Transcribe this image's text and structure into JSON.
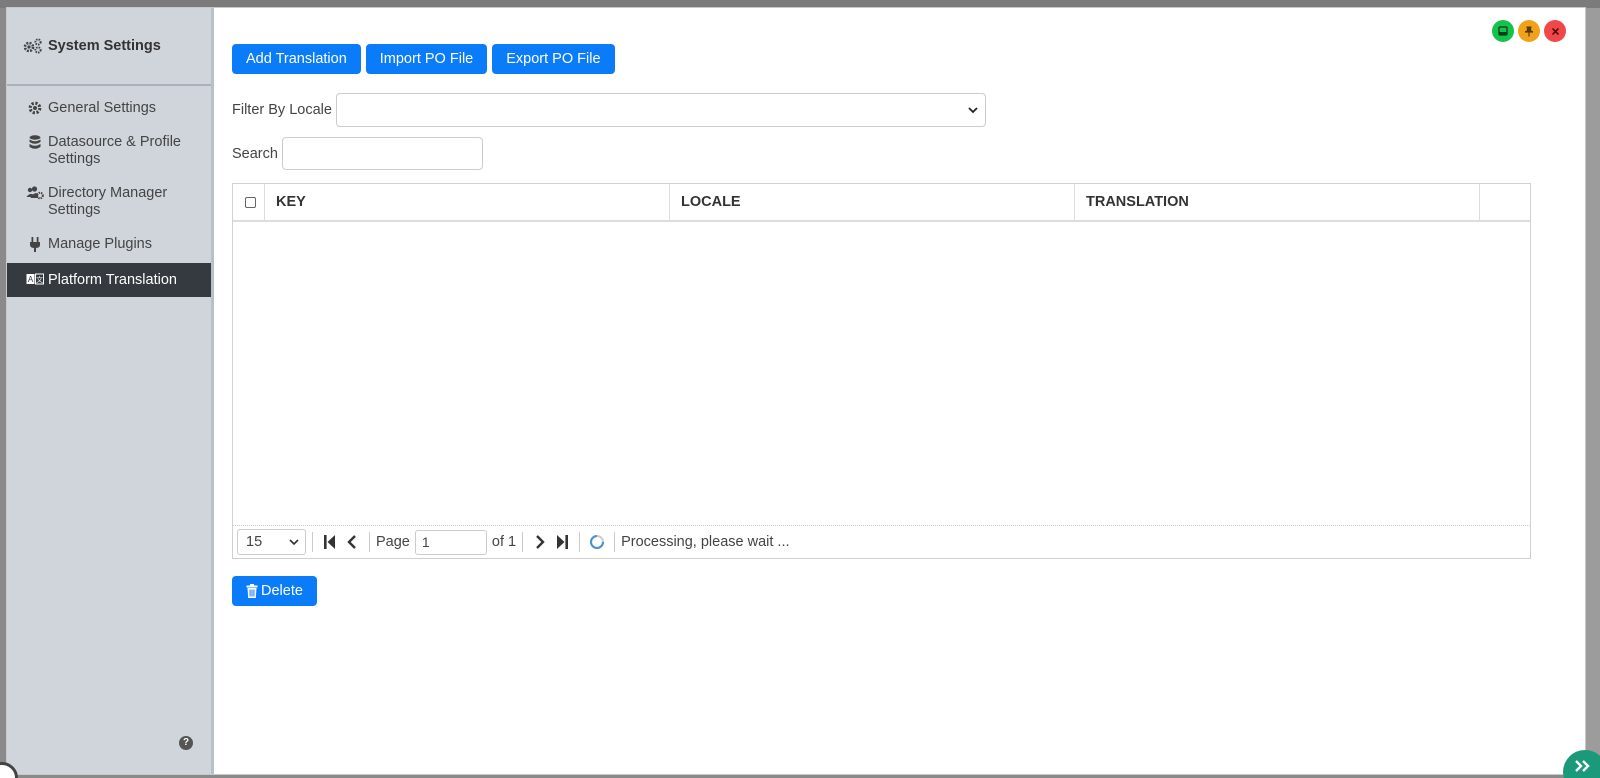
{
  "sidebar": {
    "title": "System Settings",
    "items": [
      {
        "label": "General Settings",
        "icon": "gear-icon"
      },
      {
        "label": "Datasource & Profile Settings",
        "icon": "database-icon"
      },
      {
        "label": "Directory Manager Settings",
        "icon": "users-gear-icon"
      },
      {
        "label": "Manage Plugins",
        "icon": "plug-icon"
      },
      {
        "label": "Platform Translation",
        "icon": "language-icon",
        "active": true
      }
    ]
  },
  "toolbar": {
    "add_label": "Add Translation",
    "import_label": "Import PO File",
    "export_label": "Export PO File"
  },
  "filter": {
    "label": "Filter By Locale",
    "selected": ""
  },
  "search": {
    "label": "Search",
    "value": ""
  },
  "table": {
    "columns": [
      "KEY",
      "LOCALE",
      "TRANSLATION"
    ],
    "rows": []
  },
  "pager": {
    "page_size": "15",
    "page_label": "Page",
    "page": "1",
    "of_label": "of 1",
    "status": "Processing, please wait ..."
  },
  "actions": {
    "delete_label": "Delete"
  },
  "colors": {
    "primary": "#0a7cf9",
    "sidebar_bg": "#cfd5db",
    "active_item": "#343a40"
  }
}
